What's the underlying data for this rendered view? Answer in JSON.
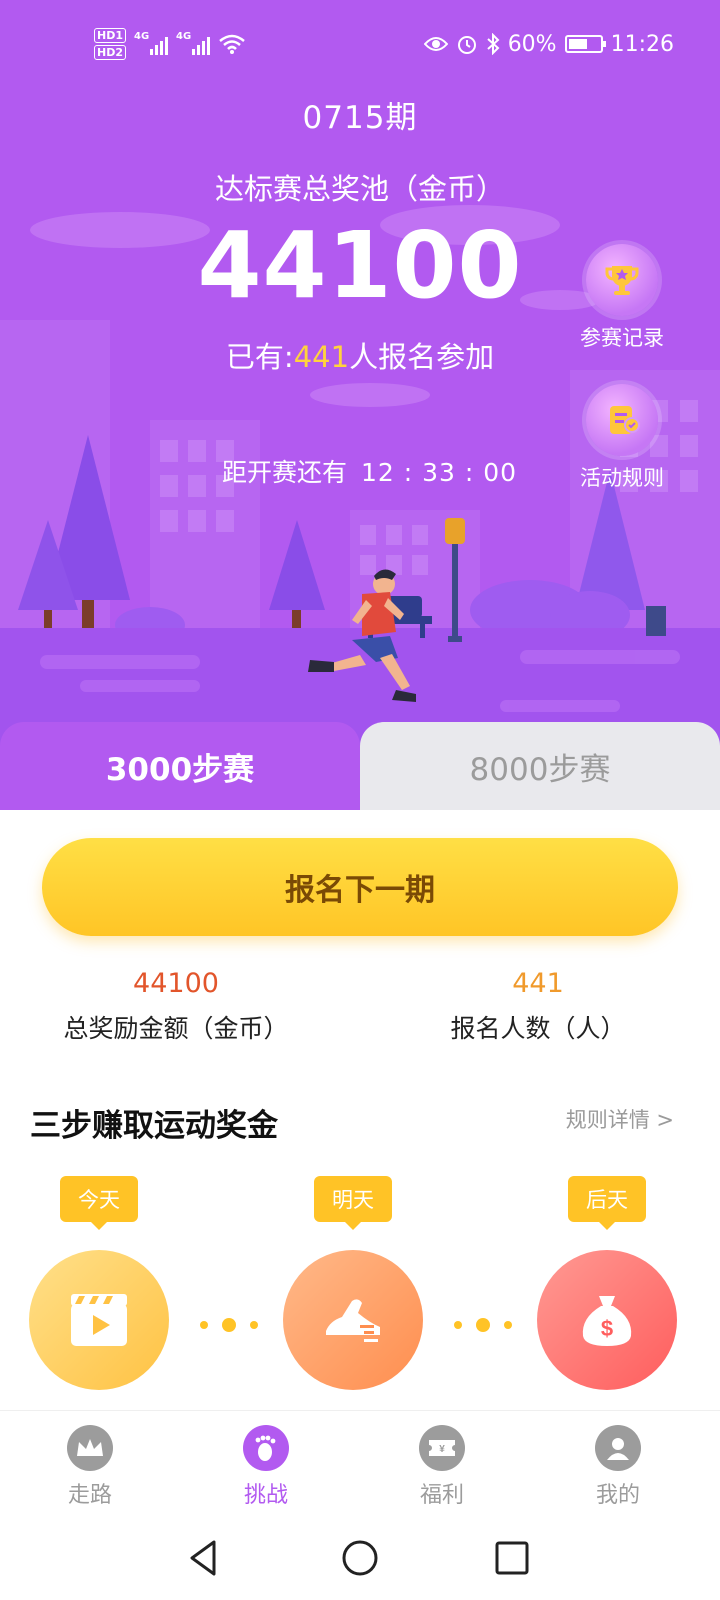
{
  "status_bar": {
    "hd_labels": [
      "HD1",
      "HD2"
    ],
    "network_labels": [
      "4G",
      "4G"
    ],
    "battery_text": "60%",
    "battery_level": 0.6,
    "time": "11:26"
  },
  "hero": {
    "period": "0715期",
    "pool_title": "达标赛总奖池（金币）",
    "pool_value": "44100",
    "joined_prefix": "已有:",
    "joined_count": "441",
    "joined_suffix": "人报名参加",
    "countdown_label": "距开赛还有",
    "countdown_time": "12 : 33 : 00",
    "side_buttons": [
      {
        "label": "参赛记录",
        "icon": "trophy-icon"
      },
      {
        "label": "活动规则",
        "icon": "rules-icon"
      }
    ],
    "background_color": "#b25af0"
  },
  "race_tabs": [
    {
      "label": "3000步赛",
      "active": true
    },
    {
      "label": "8000步赛",
      "active": false
    }
  ],
  "signup_button": {
    "label": "报名下一期"
  },
  "stats": [
    {
      "value": "44100",
      "label": "总奖励金额（金币）",
      "color": "#e2552b"
    },
    {
      "value": "441",
      "label": "报名人数（人）",
      "color": "#f09a2c"
    }
  ],
  "section": {
    "title": "三步赚取运动奖金",
    "link": "规则详情 >"
  },
  "steps": [
    {
      "tag": "今天",
      "icon": "video-icon"
    },
    {
      "tag": "明天",
      "icon": "running-shoe-icon"
    },
    {
      "tag": "后天",
      "icon": "money-bag-icon"
    }
  ],
  "bottom_nav": [
    {
      "label": "走路",
      "icon": "crown-icon",
      "active": false
    },
    {
      "label": "挑战",
      "icon": "footprint-icon",
      "active": true
    },
    {
      "label": "福利",
      "icon": "ticket-icon",
      "active": false
    },
    {
      "label": "我的",
      "icon": "profile-icon",
      "active": false
    }
  ],
  "system_nav": [
    "back-icon",
    "home-icon",
    "recents-icon"
  ],
  "colors": {
    "accent": "#b25af0",
    "gold": "#ffc326",
    "highlight": "#ffd33d"
  }
}
